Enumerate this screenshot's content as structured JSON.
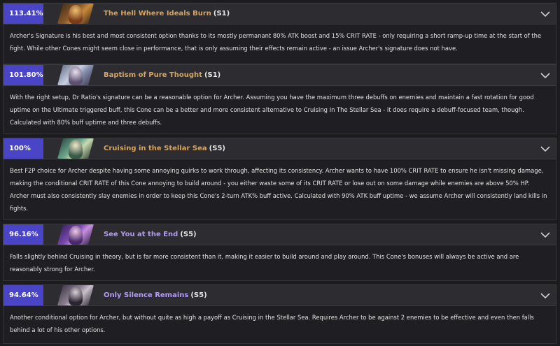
{
  "items": [
    {
      "score": "113.41%",
      "name": "The Hell Where Ideals Burn",
      "superimposition": "(S1)",
      "name_color": "gold",
      "description": "Archer's Signature is his best and most consistent option thanks to its mostly permanant 80% ATK boost and 15% CRIT RATE - only requiring a short ramp-up time at the start of the fight. While other Cones might seem close in performance, that is only assuming their effects remain active - an issue Archer's signature does not have."
    },
    {
      "score": "101.80%",
      "name": "Baptism of Pure Thought",
      "superimposition": "(S1)",
      "name_color": "gold",
      "description": "With the right setup, Dr Ratio's signature can be a reasonable option for Archer. Assuming you have the maximum three debuffs on enemies and maintain a fast rotation for good uptime on the Ultimate triggered buff, this Cone can be a better and more consistent alternative to Cruising In The Stellar Sea - it does require a debuff-focused team, though. Calculated with 80% buff uptime and three debuffs."
    },
    {
      "score": "100%",
      "name": "Cruising in the Stellar Sea",
      "superimposition": "(S5)",
      "name_color": "gold",
      "description": "Best F2P choice for Archer despite having some annoying quirks to work through, affecting its consistency. Archer wants to have 100% CRIT RATE to ensure he isn't missing damage, making the conditional CRIT RATE of this Cone annoying to build around - you either waste some of its CRIT RATE or lose out on some damage while enemies are above 50% HP. Archer must also consistently slay enemies in order to keep this Cone's 2-turn ATK% buff active. Calculated with 90% ATK buff uptime - we assume Archer will consistently land kills in fights."
    },
    {
      "score": "96.16%",
      "name": "See You at the End",
      "superimposition": "(S5)",
      "name_color": "purple",
      "description": "Falls slightly behind Cruising in theory, but is far more consistent than it, making it easier to build around and play around. This Cone's bonuses will always be active and are reasonably strong for Archer."
    },
    {
      "score": "94.64%",
      "name": "Only Silence Remains",
      "superimposition": "(S5)",
      "name_color": "purple",
      "description": "Another conditional option for Archer, but without quite as high a payoff as Cruising in the Stellar Sea. Requires Archer to be against 2 enemies to be effective and even then falls behind a lot of his other options."
    }
  ],
  "icons": {
    "expand": "chevron-down-icon",
    "thumbnail": "light-cone-art"
  },
  "colors": {
    "score_bg": "#4a44c6",
    "gold_name": "#d6a460",
    "purple_name": "#b39cf2"
  }
}
